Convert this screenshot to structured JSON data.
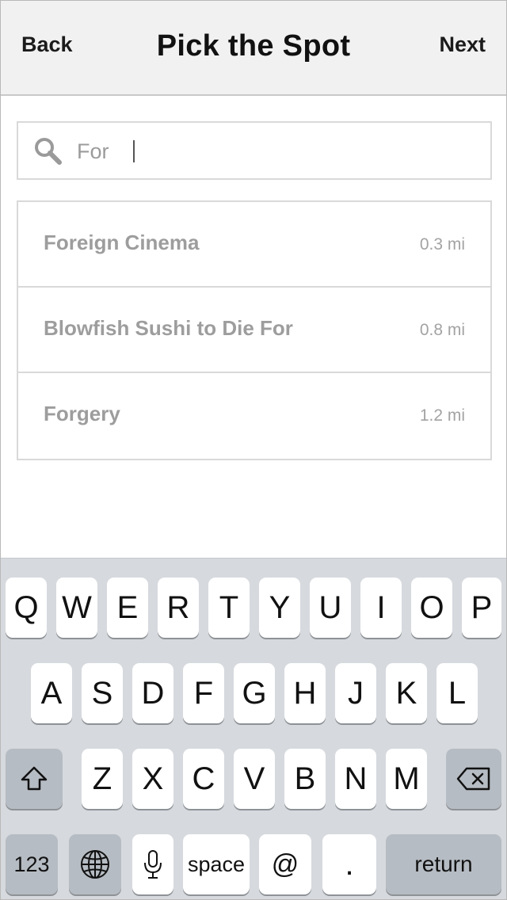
{
  "nav": {
    "back_label": "Back",
    "title": "Pick the Spot",
    "next_label": "Next"
  },
  "search": {
    "value": "For ",
    "icon": "search-icon"
  },
  "results": [
    {
      "name": "Foreign Cinema",
      "distance": "0.3 mi"
    },
    {
      "name": "Blowfish Sushi to Die For",
      "distance": "0.8 mi"
    },
    {
      "name": "Forgery",
      "distance": "1.2 mi"
    }
  ],
  "keyboard": {
    "row1": [
      "Q",
      "W",
      "E",
      "R",
      "T",
      "Y",
      "U",
      "I",
      "O",
      "P"
    ],
    "row2": [
      "A",
      "S",
      "D",
      "F",
      "G",
      "H",
      "J",
      "K",
      "L"
    ],
    "row3": [
      "Z",
      "X",
      "C",
      "V",
      "B",
      "N",
      "M"
    ],
    "numbers_label": "123",
    "space_label": "space",
    "at_label": "@",
    "period_label": ".",
    "return_label": "return",
    "shift_icon": "shift-icon",
    "delete_icon": "delete-icon",
    "globe_icon": "globe-icon",
    "mic_icon": "microphone-icon"
  },
  "colors": {
    "navbar_bg": "#f1f1f1",
    "keyboard_bg": "#d6d9dd",
    "key_dark": "#b6bcc3",
    "result_text": "#9d9d9d"
  }
}
